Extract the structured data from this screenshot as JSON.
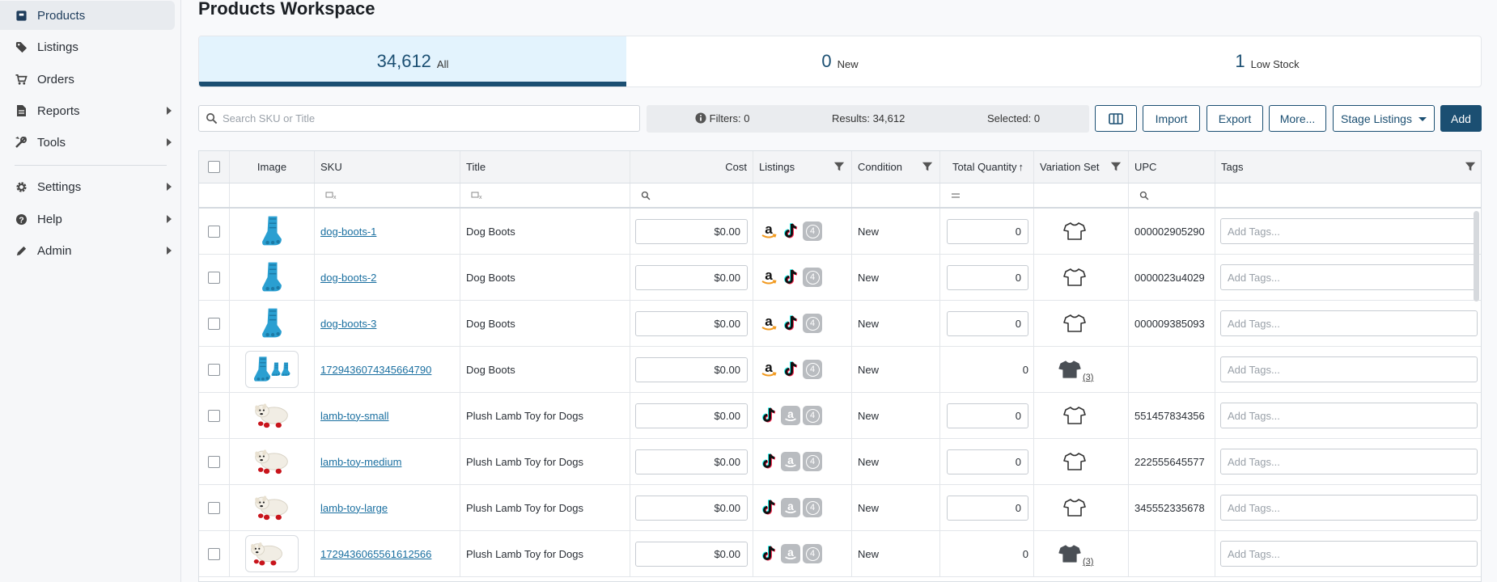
{
  "sidebar": {
    "items": [
      {
        "label": "Products",
        "active": true
      },
      {
        "label": "Listings"
      },
      {
        "label": "Orders"
      },
      {
        "label": "Reports",
        "has_submenu": true
      },
      {
        "label": "Tools",
        "has_submenu": true
      },
      {
        "label": "Settings",
        "has_submenu": true
      },
      {
        "label": "Help",
        "has_submenu": true
      },
      {
        "label": "Admin",
        "has_submenu": true
      }
    ]
  },
  "header": {
    "title": "Products Workspace"
  },
  "stats": [
    {
      "count": "34,612",
      "label": "All",
      "active": true
    },
    {
      "count": "0",
      "label": "New"
    },
    {
      "count": "1",
      "label": "Low Stock"
    }
  ],
  "toolbar": {
    "search_placeholder": "Search SKU or Title",
    "filters": "Filters: 0",
    "results": "Results: 34,612",
    "selected": "Selected: 0",
    "import": "Import",
    "export": "Export",
    "more": "More...",
    "stage": "Stage Listings",
    "add": "Add"
  },
  "table": {
    "headers": {
      "image": "Image",
      "sku": "SKU",
      "title": "Title",
      "cost": "Cost",
      "listings": "Listings",
      "condition": "Condition",
      "total_quantity": "Total Quantity",
      "variation_set": "Variation Set",
      "upc": "UPC",
      "tags": "Tags"
    },
    "tags_placeholder": "Add Tags...",
    "rows": [
      {
        "sku": "dog-boots-1",
        "title": "Dog Boots",
        "cost": "$0.00",
        "condition": "New",
        "qty": "0",
        "upc": "000002905290"
      },
      {
        "sku": "dog-boots-2",
        "title": "Dog Boots",
        "cost": "$0.00",
        "condition": "New",
        "qty": "0",
        "upc": "0000023u4029"
      },
      {
        "sku": "dog-boots-3",
        "title": "Dog Boots",
        "cost": "$0.00",
        "condition": "New",
        "qty": "0",
        "upc": "000009385093"
      },
      {
        "sku": "1729436074345664790",
        "title": "Dog Boots",
        "cost": "$0.00",
        "condition": "New",
        "qty": "0",
        "variation_count": "(3)",
        "upc": ""
      },
      {
        "sku": "lamb-toy-small",
        "title": "Plush Lamb Toy for Dogs",
        "cost": "$0.00",
        "condition": "New",
        "qty": "0",
        "upc": "551457834356"
      },
      {
        "sku": "lamb-toy-medium",
        "title": "Plush Lamb Toy for Dogs",
        "cost": "$0.00",
        "condition": "New",
        "qty": "0",
        "upc": "222555645577"
      },
      {
        "sku": "lamb-toy-large",
        "title": "Plush Lamb Toy for Dogs",
        "cost": "$0.00",
        "condition": "New",
        "qty": "0",
        "upc": "345552335678"
      },
      {
        "sku": "1729436065561612566",
        "title": "Plush Lamb Toy for Dogs",
        "cost": "$0.00",
        "condition": "New",
        "qty": "0",
        "variation_count": "(3)",
        "upc": ""
      }
    ]
  },
  "colors": {
    "brand": "#1b4f72",
    "link": "#1a6fa0",
    "stat_active_bg": "#e3f3fd",
    "dog_boot": "#2a9fd1"
  }
}
